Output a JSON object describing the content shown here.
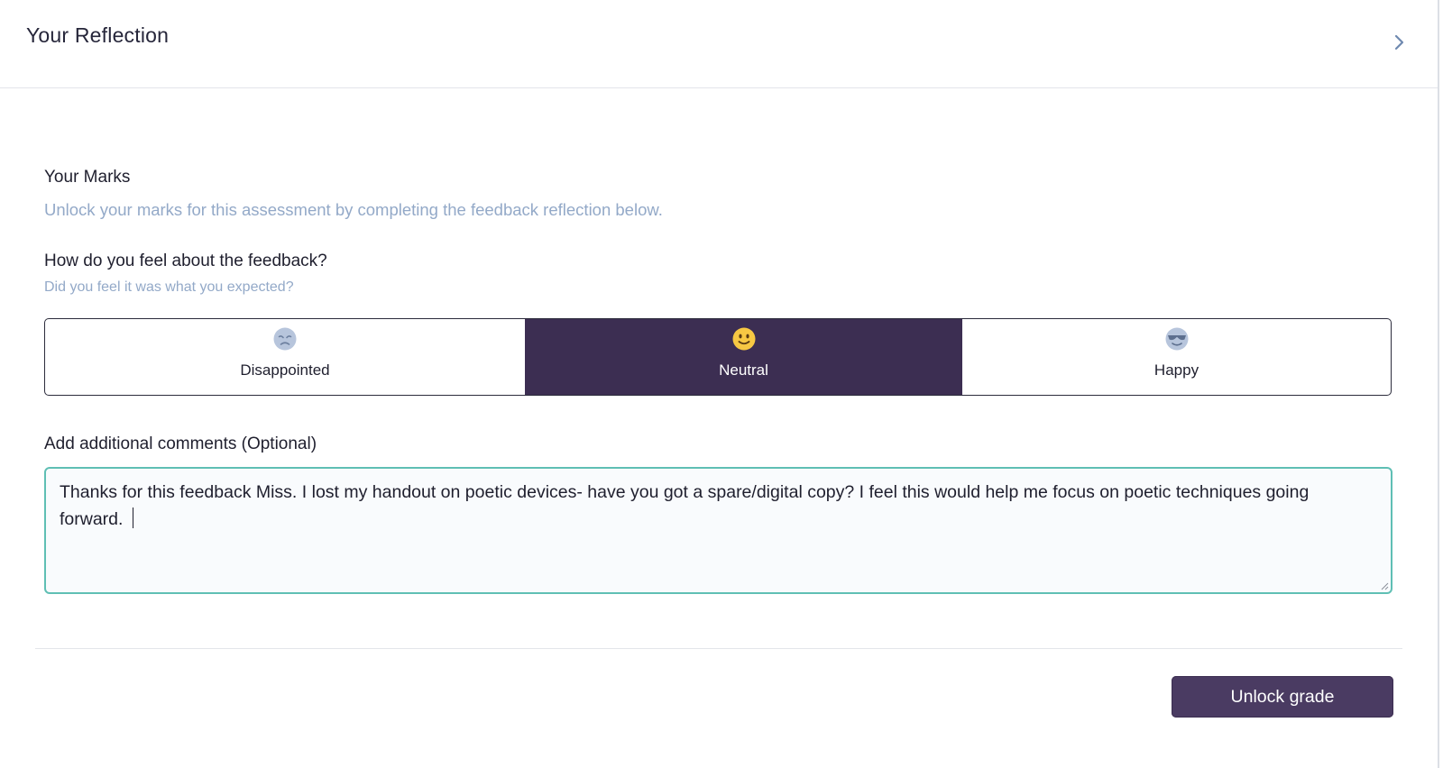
{
  "header": {
    "title": "Your Reflection",
    "chevron_icon": "chevron-right-icon"
  },
  "marks": {
    "title": "Your Marks",
    "subtitle": "Unlock your marks for this assessment by completing the feedback reflection below."
  },
  "feeling": {
    "question": "How do you feel about the feedback?",
    "subtext": "Did you feel it was what you expected?",
    "selected": "Neutral",
    "options": [
      {
        "label": "Disappointed",
        "icon": "disappointed-face-icon"
      },
      {
        "label": "Neutral",
        "icon": "slightly-smiling-face-icon"
      },
      {
        "label": "Happy",
        "icon": "sunglasses-face-icon"
      }
    ]
  },
  "comments": {
    "label": "Add additional comments (Optional)",
    "value": "Thanks for this feedback Miss. I lost my handout on poetic devices- have you got a spare/digital copy? I feel this would help me focus on poetic techniques going forward. "
  },
  "actions": {
    "unlock_label": "Unlock grade"
  },
  "colors": {
    "accent": "#3c2e52",
    "button": "#4a3b62",
    "focus_border": "#5fbfb4",
    "muted_text": "#93a9c8"
  }
}
